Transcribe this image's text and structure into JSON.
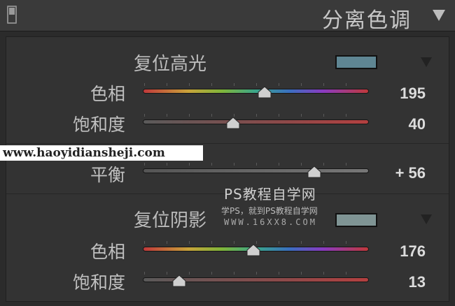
{
  "panel": {
    "title": "分离色调",
    "colors": {
      "highlight_swatch": "#5f8693",
      "shadow_swatch": "#7f9494"
    }
  },
  "highlights": {
    "label": "复位高光",
    "hue": {
      "label": "色相",
      "value": "195",
      "fraction": 0.54
    },
    "saturation": {
      "label": "饱和度",
      "value": "40",
      "fraction": 0.4
    }
  },
  "balance": {
    "label": "平衡",
    "value": "+ 56",
    "fraction": 0.76
  },
  "shadows": {
    "label": "复位阴影",
    "hue": {
      "label": "色相",
      "value": "176",
      "fraction": 0.49
    },
    "saturation": {
      "label": "饱和度",
      "value": "13",
      "fraction": 0.16
    }
  },
  "watermarks": {
    "url": "www.haoyidiansheji.com",
    "brand": "PS教程自学网",
    "tagline": "学PS，就到PS教程自学网",
    "site": "WWW.16XX8.COM"
  }
}
